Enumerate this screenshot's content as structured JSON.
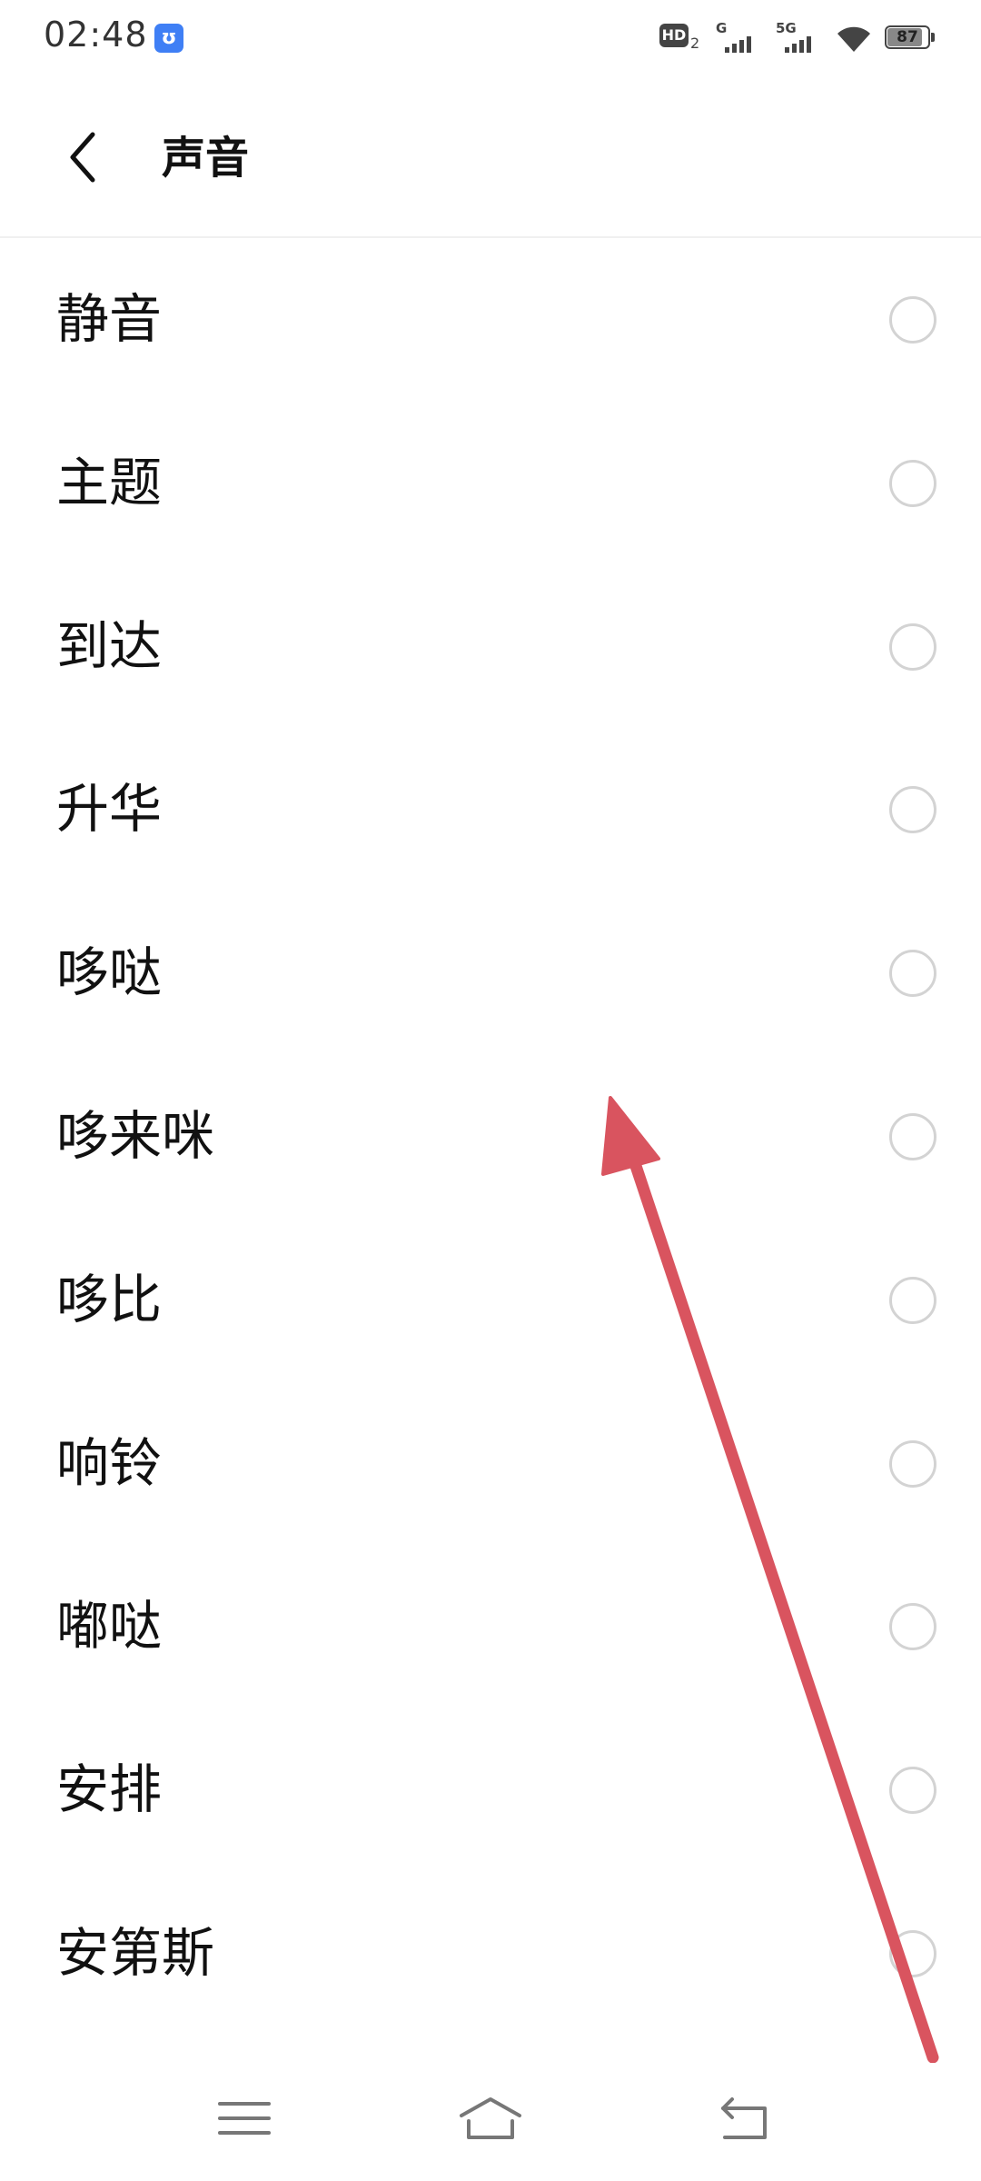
{
  "status_bar": {
    "time": "02:48",
    "app_icon": "ʊ",
    "hd_label": "HD",
    "hd_sub": "2",
    "signal_1_label": "G",
    "signal_2_label": "5G",
    "battery_level": "87",
    "battery_fraction": 0.87
  },
  "header": {
    "title": "声音",
    "back_icon": "chevron-left-icon"
  },
  "sound_list": {
    "items": [
      {
        "label": "静音",
        "selected": false
      },
      {
        "label": "主题",
        "selected": false
      },
      {
        "label": "到达",
        "selected": false
      },
      {
        "label": "升华",
        "selected": false
      },
      {
        "label": "哆哒",
        "selected": false
      },
      {
        "label": "哆来咪",
        "selected": false
      },
      {
        "label": "哆比",
        "selected": false
      },
      {
        "label": "响铃",
        "selected": false
      },
      {
        "label": "嘟哒",
        "selected": false
      },
      {
        "label": "安排",
        "selected": false
      },
      {
        "label": "安第斯",
        "selected": false
      }
    ]
  },
  "overlay": {
    "icon": "swipe-up-arrow",
    "color": "#d9545f"
  },
  "nav_bar": {
    "menu_icon": "menu-icon",
    "home_icon": "home-icon",
    "back_icon": "back-icon"
  }
}
